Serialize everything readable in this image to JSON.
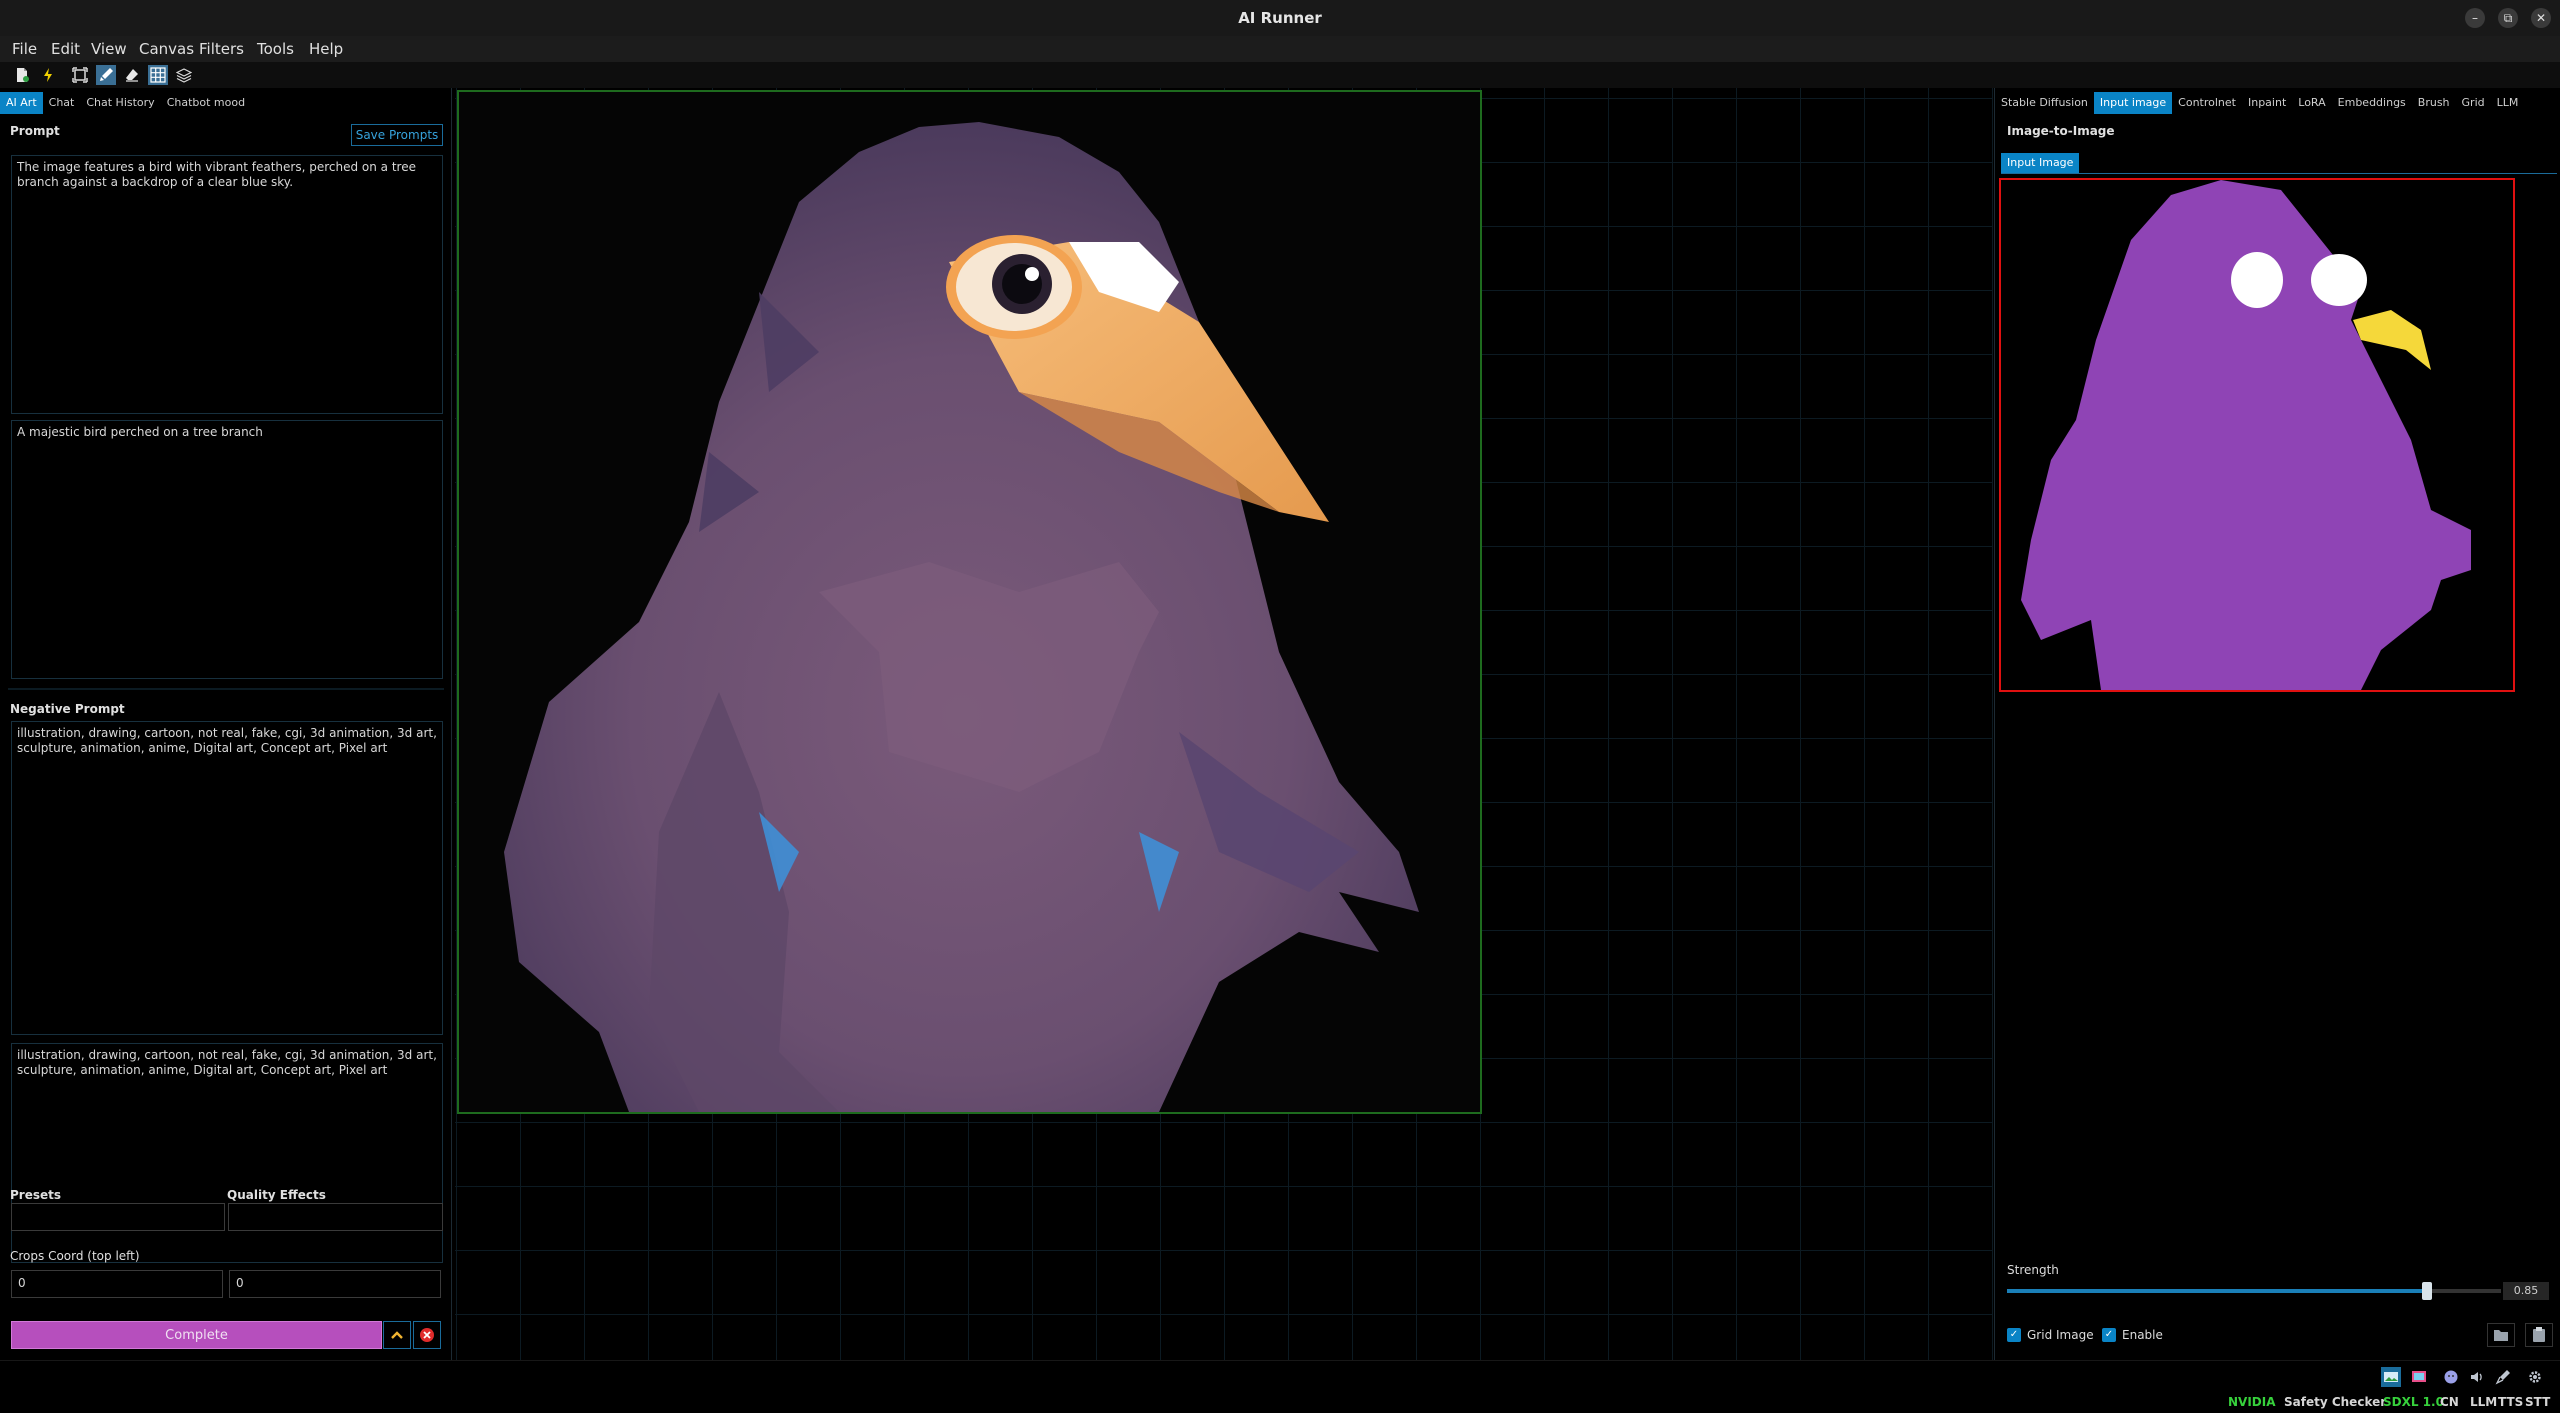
{
  "window": {
    "title": "AI Runner",
    "minimize": "–",
    "restore": "⧉",
    "close": "✕"
  },
  "menu": [
    "File",
    "Edit",
    "View",
    "Canvas",
    "Filters",
    "Tools",
    "Help"
  ],
  "left_tabs": [
    {
      "label": "AI Art",
      "active": true
    },
    {
      "label": "Chat",
      "active": false
    },
    {
      "label": "Chat History",
      "active": false
    },
    {
      "label": "Chatbot mood",
      "active": false
    }
  ],
  "prompt": {
    "label": "Prompt",
    "save_button": "Save Prompts",
    "primary": "The image features a bird with vibrant feathers, perched on a tree branch against a backdrop of a clear blue sky.",
    "secondary": "A majestic bird perched on a tree branch"
  },
  "negative_prompt": {
    "label": "Negative Prompt",
    "primary": "illustration, drawing, cartoon, not real, fake, cgi, 3d animation, 3d art, sculpture, animation, anime, Digital art, Concept art, Pixel art",
    "secondary": "illustration, drawing, cartoon, not real, fake, cgi, 3d animation, 3d art, sculpture, animation, anime, Digital art, Concept art, Pixel art"
  },
  "presets": {
    "label": "Presets",
    "value": ""
  },
  "quality_effects": {
    "label": "Quality Effects",
    "value": ""
  },
  "crops": {
    "label": "Crops Coord (top left)",
    "x": "0",
    "y": "0"
  },
  "generate": {
    "label": "Complete",
    "up_icon": "^",
    "cancel_icon": "✕"
  },
  "right_tabs": [
    {
      "label": "Stable Diffusion",
      "active": false
    },
    {
      "label": "Input image",
      "active": true
    },
    {
      "label": "Controlnet",
      "active": false
    },
    {
      "label": "Inpaint",
      "active": false
    },
    {
      "label": "LoRA",
      "active": false
    },
    {
      "label": "Embeddings",
      "active": false
    },
    {
      "label": "Brush",
      "active": false
    },
    {
      "label": "Grid",
      "active": false
    },
    {
      "label": "LLM",
      "active": false
    }
  ],
  "img2img": {
    "title": "Image-to-Image",
    "subtab": "Input Image",
    "strength_label": "Strength",
    "strength_value": "0.85",
    "strength_fraction": 0.85,
    "grid_image_label": "Grid Image",
    "grid_image_checked": true,
    "enable_label": "Enable",
    "enable_checked": true
  },
  "status": {
    "nvidia": "NVIDIA",
    "safety_checker": "Safety Checker",
    "model": "SDXL 1.0",
    "cn": "CN",
    "llm": "LLM",
    "tts": "TTS",
    "stt": "STT"
  },
  "colors": {
    "accent": "#0a84c6",
    "generate_button": "#b64fbd",
    "status_green": "#37d13c",
    "input_border": "#e01010",
    "active_frame": "#1e6b1e"
  }
}
